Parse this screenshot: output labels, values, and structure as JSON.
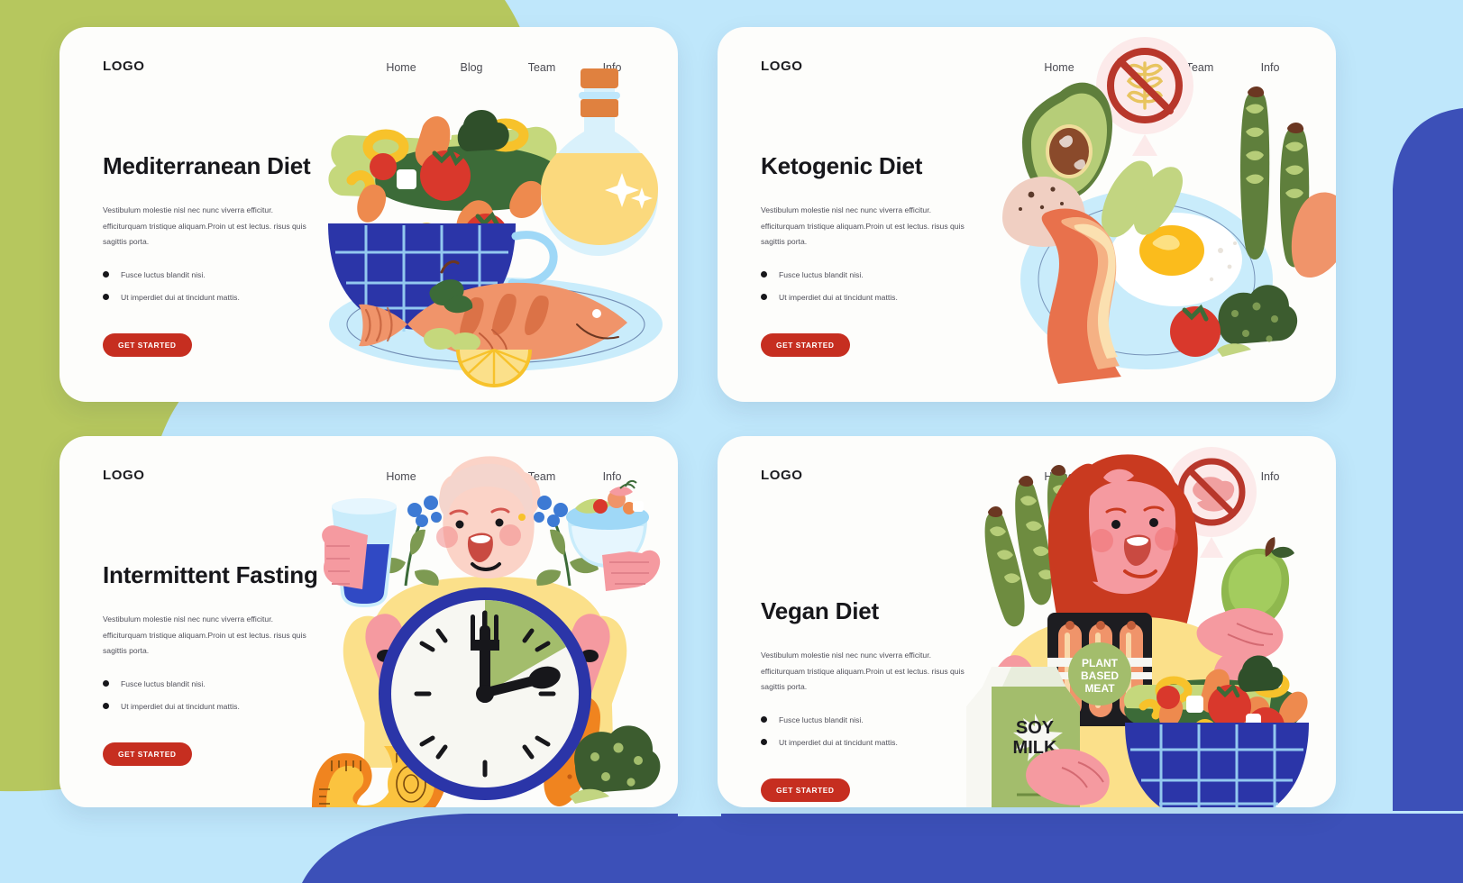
{
  "background": {
    "base_color": "#bfe7fb",
    "green_color": "#b6c75e",
    "blue_color": "#3c50b8",
    "white_color": "#ffffff"
  },
  "theme": {
    "accent": "#c62e20",
    "title_color": "#17171b",
    "body_color": "#50505a",
    "card_bg": "#fdfdfb"
  },
  "nav_items": [
    "Home",
    "Blog",
    "Team",
    "Info"
  ],
  "logo_text": "LOGO",
  "shared": {
    "paragraph": "Vestibulum molestie nisl nec nunc viverra efficitur. efficiturquam tristique aliquam.Proin ut est lectus. risus quis sagittis porta.",
    "bullet_1": "Fusce luctus blandit nisi.",
    "bullet_2": "Ut imperdiet dui at tincidunt mattis.",
    "cta_label": "GET STARTED"
  },
  "cards": [
    {
      "title": "Mediterranean Diet",
      "illustration": "mediterranean-salad-bowl-fish-oil"
    },
    {
      "title": "Ketogenic Diet",
      "illustration": "keto-plate-bacon-egg-avocado",
      "badge": "no-gluten-icon"
    },
    {
      "title": "Intermittent Fasting",
      "illustration": "person-clock-measuring-tape"
    },
    {
      "title": "Vegan Diet",
      "illustration": "woman-soy-milk-plant-based-meat-salad",
      "badge": "no-meat-icon",
      "labels": {
        "soy_milk": "SOY\nMILK",
        "soy_milk_line1": "SOY",
        "soy_milk_line2": "MILK",
        "plant_meat_line1": "PLANT",
        "plant_meat_line2": "BASED",
        "plant_meat_line3": "MEAT"
      }
    }
  ]
}
